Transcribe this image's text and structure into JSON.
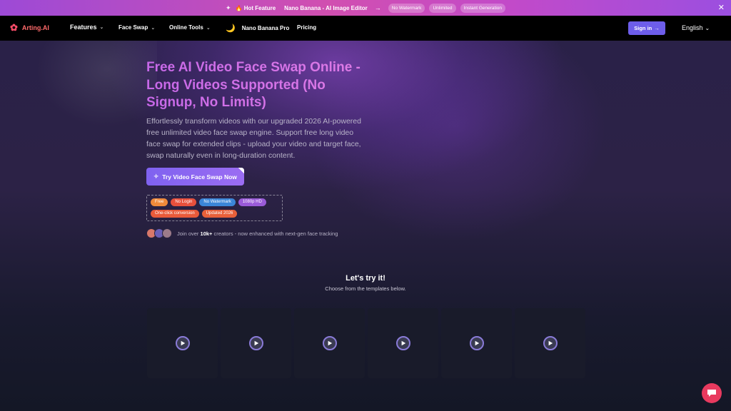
{
  "promo": {
    "hot_label": "🔥 Hot Feature",
    "feature": "Nano Banana - AI Image Editor",
    "pills": [
      "No Watermark",
      "Unlimited",
      "Instant Generation"
    ]
  },
  "nav": {
    "brand": "Arting.AI",
    "features": "Features",
    "face_swap": "Face Swap",
    "online_tools": "Online Tools",
    "nano": "Nano Banana Pro",
    "pricing": "Pricing",
    "signin": "Sign in",
    "language": "English"
  },
  "hero": {
    "title": "Free AI Video Face Swap Online - Long Videos Supported (No Signup, No Limits)",
    "description": "Effortlessly transform videos with our upgraded 2026 AI-powered free unlimited video face swap engine. Support free long video face swap for extended clips - upload your video and target face, swap naturally even in long-duration content.",
    "cta": "Try Video Face Swap Now",
    "tags": [
      {
        "label": "Free",
        "color": "#f08a3a"
      },
      {
        "label": "No Login",
        "color": "#e8503c"
      },
      {
        "label": "No Watermark",
        "color": "#3b86d8"
      },
      {
        "label": "1080p HD",
        "color": "#9a5bd8"
      },
      {
        "label": "One-click conversion",
        "color": "#e85a3a"
      },
      {
        "label": "Updated 2026",
        "color": "#e8603a"
      }
    ],
    "proof_prefix": "Join over",
    "proof_count": "10k+",
    "proof_suffix": "creators - now enhanced with next-gen face tracking"
  },
  "try": {
    "title": "Let's try it!",
    "subtitle": "Choose from the templates below."
  },
  "colors": {
    "accent": "#6d5dea",
    "chat": "#e83a5f"
  }
}
